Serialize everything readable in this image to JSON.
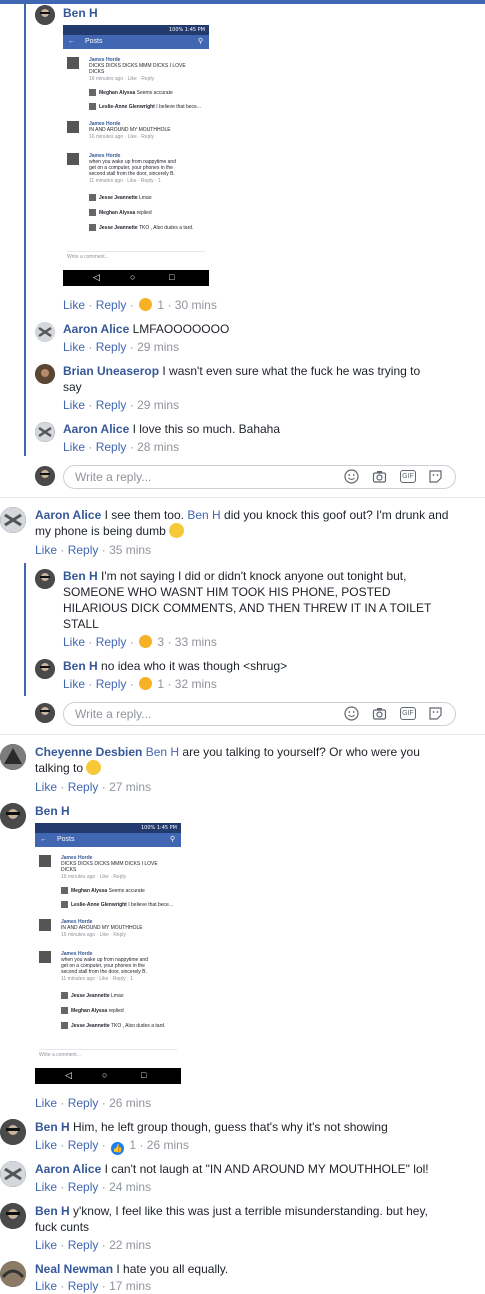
{
  "ui": {
    "like": "Like",
    "reply": "Reply",
    "dot": "·",
    "reply_placeholder": "Write a reply...",
    "gif": "GIF"
  },
  "colors": {
    "accent": "#4267b2",
    "name": "#365899",
    "meta": "#90949c"
  },
  "icons": [
    "smiley-icon",
    "camera-icon",
    "gif-icon",
    "sticker-icon",
    "haha-reaction-icon",
    "like-reaction-icon"
  ],
  "screenshot": {
    "status": "100% 1:45 PM",
    "title": "Posts",
    "back": "←",
    "search": "⚲",
    "write_comment": "Write a comment...",
    "nav_back": "◁",
    "nav_home": "○",
    "nav_recent": "□",
    "posts": [
      {
        "author": "James Horde",
        "text1": "DICKS DICKS DICKS MMM DICKS I LOVE",
        "text2": "DICKS",
        "meta": "16 minutes ago · Like · Reply"
      },
      {
        "author": "Meghan Alyssa",
        "text1": "Seems accurate"
      },
      {
        "author": "Leslie-Anne Glenwright",
        "text1": "I believe that bece..."
      },
      {
        "author": "James Horde",
        "text1": "IN AND AROUND MY MOUTHHOLE",
        "meta": "16 minutes ago · Like · Reply"
      },
      {
        "author": "James Horde",
        "text1": "when you wake up from nappytime and",
        "text2": "get on a computer, your phones in the",
        "text3": "second stall from the door, sincerely B.",
        "meta": "11 minutes ago · Like · Reply · 1"
      },
      {
        "author": "Jesse Jeannette",
        "text1": "Lmao"
      },
      {
        "author": "Meghan Alyssa",
        "text1": "replied"
      },
      {
        "author": "Jesse Jeannette",
        "text1": "TKO , Also dudes a tard."
      }
    ]
  },
  "comments": {
    "c1": {
      "name": "Ben H",
      "time": "30 mins",
      "reactions": "1"
    },
    "c2": {
      "name": "Aaron Alice",
      "text": "LMFAOOOOOOO",
      "time": "29 mins"
    },
    "c3": {
      "name": "Brian Uneaserop",
      "text1": "I wasn't even sure what the fuck he was trying to",
      "text2": "say",
      "time": "29 mins"
    },
    "c4": {
      "name": "Aaron Alice",
      "text": "I love this so much. Bahaha",
      "time": "28 mins"
    },
    "c5": {
      "name": "Aaron Alice",
      "text1a": "I see them too.",
      "mention": "Ben H",
      "text1b": "did you knock this goof out? I'm drunk and",
      "text2": "my phone is being dumb",
      "time": "35 mins"
    },
    "c6": {
      "name": "Ben H",
      "text1": "I'm not saying I did or didn't knock anyone out tonight but,",
      "text2": "SOMEONE WHO WASNT HIM TOOK HIS PHONE, POSTED",
      "text3": "HILARIOUS DICK COMMENTS, AND THEN THREW IT IN A TOILET",
      "text4": "STALL",
      "time": "33 mins",
      "reactions": "3"
    },
    "c7": {
      "name": "Ben H",
      "text": "no idea who it was though <shrug>",
      "time": "32 mins",
      "reactions": "1"
    },
    "c8": {
      "name": "Cheyenne Desbien",
      "mention": "Ben H",
      "text1": "are you talking to yourself? Or who were you",
      "text2": "talking to",
      "time": "27 mins"
    },
    "c9": {
      "name": "Ben H",
      "time": "26 mins"
    },
    "c10": {
      "name": "Ben H",
      "text": "Him, he left group though, guess that's why it's not showing",
      "time": "26 mins",
      "reactions": "1"
    },
    "c11": {
      "name": "Aaron Alice",
      "text": "I can't not laugh at \"IN AND AROUND MY MOUTHHOLE\" lol!",
      "time": "24 mins"
    },
    "c12": {
      "name": "Ben H",
      "text1": "y'know, I feel like this was just a terrible misunderstanding. but hey,",
      "text2": "fuck cunts",
      "time": "22 mins"
    },
    "c13": {
      "name": "Neal Newman",
      "text": "I hate you all equally.",
      "time": "17 mins"
    }
  }
}
